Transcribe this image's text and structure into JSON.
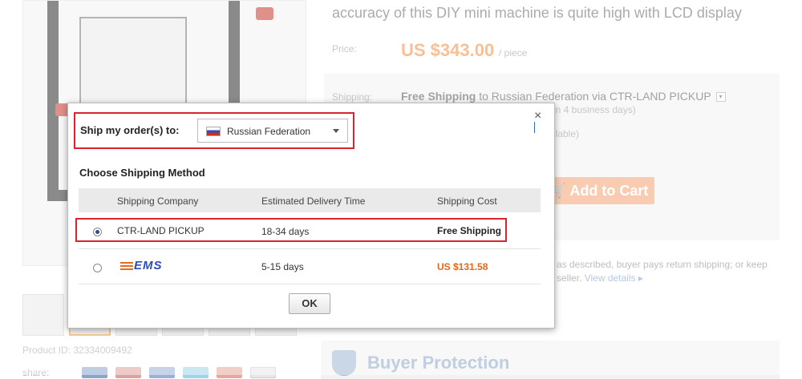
{
  "page": {
    "title_line": "accuracy of this DIY mini machine is quite high with LCD display",
    "price_label": "Price:",
    "price": "US $343.00",
    "price_unit": "/ piece",
    "shipping_label": "Shipping:",
    "shipping_bold": "Free Shipping",
    "shipping_rest": "to Russian Federation via CTR-LAND PICKUP",
    "shipping_partial_1": "in 4 business days)",
    "shipping_partial_2": "ilable)",
    "add_to_cart": "Add to Cart",
    "returns_line_1": "as described, buyer pays return shipping; or keep",
    "returns_line_2": "seller.",
    "view_details": "View details",
    "buyer_protection": "Buyer Protection",
    "product_id": "Product ID: 32334009492",
    "share_label": "share:"
  },
  "dialog": {
    "ship_to_label": "Ship my order(s) to:",
    "country": "Russian Federation",
    "method_title": "Choose Shipping Method",
    "close_glyph": "×",
    "headers": {
      "company": "Shipping Company",
      "delivery": "Estimated Delivery Time",
      "cost": "Shipping Cost"
    },
    "rows": [
      {
        "company": "CTR-LAND PICKUP",
        "delivery": "18-34 days",
        "cost": "Free Shipping",
        "selected": true
      },
      {
        "company": "EMS",
        "delivery": "5-15 days",
        "cost": "US $131.58",
        "selected": false
      }
    ],
    "ok_label": "OK"
  },
  "colors": {
    "accent_red": "#d9232e",
    "price_orange": "#f48a3e",
    "ems_cost_orange": "#e8661a",
    "ems_blue": "#2a4fb8"
  }
}
